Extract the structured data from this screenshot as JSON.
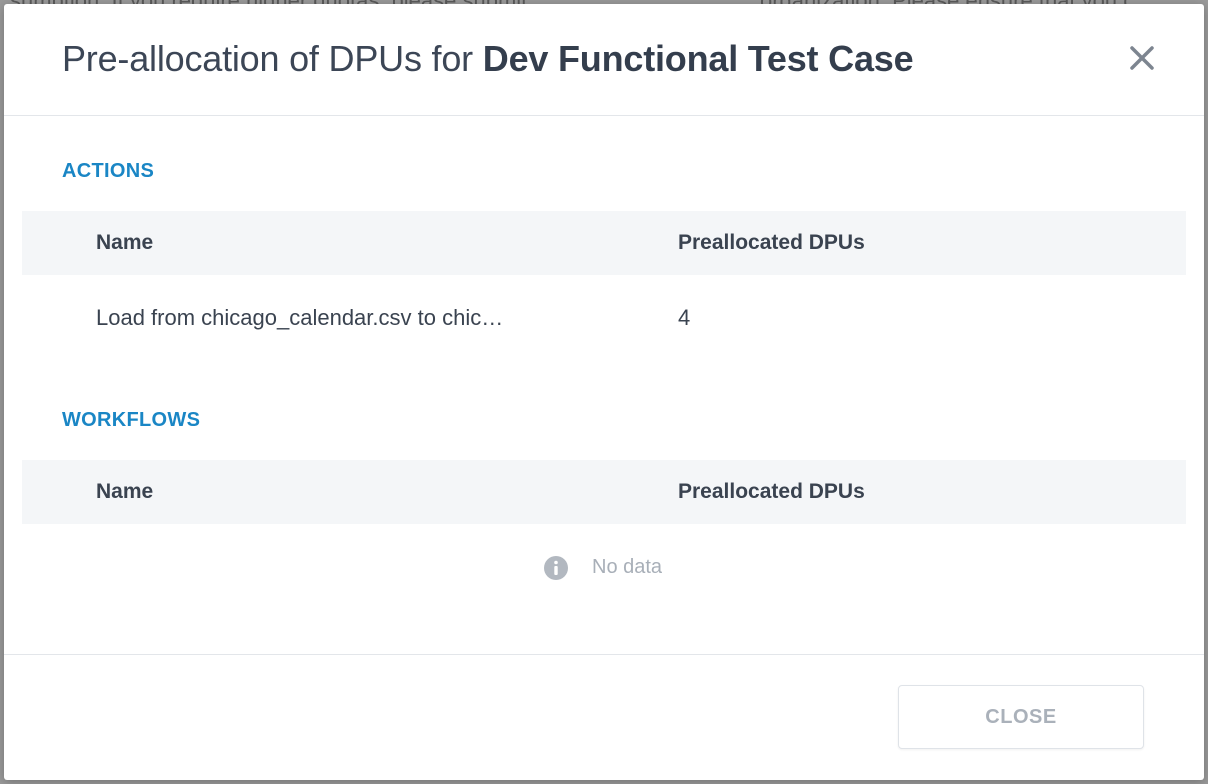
{
  "modal": {
    "title_prefix": "Pre-allocation of DPUs for ",
    "title_bold": "Dev Functional Test Case",
    "close_icon": "close-icon"
  },
  "actions": {
    "section_label": "ACTIONS",
    "columns": [
      "Name",
      "Preallocated DPUs"
    ],
    "rows": [
      {
        "name": "Load from chicago_calendar.csv to chic…",
        "dpus": "4"
      }
    ]
  },
  "workflows": {
    "section_label": "WORKFLOWS",
    "columns": [
      "Name",
      "Preallocated DPUs"
    ],
    "rows": [],
    "empty_text": "No data",
    "empty_icon": "info-icon"
  },
  "footer": {
    "close_label": "CLOSE"
  },
  "colors": {
    "accent": "#1a86c5",
    "title": "#3c4656",
    "muted": "#a8afb8",
    "header_bg": "#f4f6f8"
  }
}
